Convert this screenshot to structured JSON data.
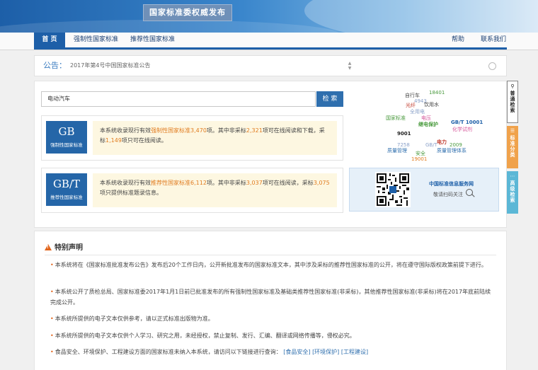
{
  "header": {
    "banner_title": "国家标准委权威发布"
  },
  "nav": {
    "left": [
      "首 页",
      "强制性国家标准",
      "推荐性国家标准"
    ],
    "right": [
      "帮助",
      "联系我们"
    ]
  },
  "notice": {
    "label": "公告：",
    "text": "2017年第4号中国国家标准公告"
  },
  "search": {
    "value": "电动汽车",
    "button_label": "检 索"
  },
  "gb": {
    "code": "GB",
    "name": "强制性国家标准",
    "desc_prefix": "本系统收录现行有效",
    "desc_link": "强制性国家标准",
    "total": "3,470",
    "desc_mid1": "项。其中非采标",
    "non_adopted": "2,321",
    "desc_mid2": "项可在线阅读和下载，采标",
    "adopted": "1,149",
    "desc_end": "项只可在线阅读。"
  },
  "gbt": {
    "code": "GB/T",
    "name": "推荐性国家标准",
    "desc_prefix": "本系统收录现行有效",
    "desc_link": "推荐性国家标准",
    "total": "6,112",
    "desc_mid1": "项。其中非采标",
    "non_adopted": "3,037",
    "desc_mid2": "项可在线阅读，采标",
    "adopted": "3,075",
    "desc_end": "项只提供标准题录信息。"
  },
  "word_cloud": [
    {
      "text": "18401",
      "color": "#4a9a3e"
    },
    {
      "text": "自行车",
      "color": "#444444"
    },
    {
      "text": "4943",
      "color": "#8aa0c8"
    },
    {
      "text": "光纤",
      "color": "#c0392b"
    },
    {
      "text": "饮用水",
      "color": "#444444"
    },
    {
      "text": "全用电",
      "color": "#8aa0c8"
    },
    {
      "text": "国家标准",
      "color": "#4a9a3e"
    },
    {
      "text": "电压",
      "color": "#d6569a"
    },
    {
      "text": "继电保护",
      "color": "#4a9a3e"
    },
    {
      "text": "GB/T 10001",
      "color": "#1d5fa8"
    },
    {
      "text": "化学试剂",
      "color": "#d6569a"
    },
    {
      "text": "9001",
      "color": "#222222"
    },
    {
      "text": "7258",
      "color": "#8aa0c8"
    },
    {
      "text": "GB/T",
      "color": "#8aa0c8"
    },
    {
      "text": "电力",
      "color": "#c0392b"
    },
    {
      "text": "2009",
      "color": "#4a9a3e"
    },
    {
      "text": "质量管理",
      "color": "#2f6fae"
    },
    {
      "text": "安全",
      "color": "#4a9a3e"
    },
    {
      "text": "质量管理体系",
      "color": "#2f6fae"
    },
    {
      "text": "19001",
      "color": "#e07b1f"
    }
  ],
  "qr": {
    "title": "中国标准信息服务网",
    "subtitle": "敬请扫码关注"
  },
  "side_tabs": [
    {
      "label": "普通检索"
    },
    {
      "label": "标准分类"
    },
    {
      "label": "高级检索"
    }
  ],
  "statement": {
    "title": "特别声明",
    "items": [
      "本系统将在《国家标准批准发布公告》发布后20个工作日内，公开新批准发布的国家标准文本，其中涉及采标的推荐性国家标准的公开，将在遵守国际版权政策前提下进行。",
      "本系统公开了质检总局、国家标准委2017年1月1日前已批准发布的所有强制性国家标准及基础类推荐性国家标准(非采标)，其他推荐性国家标准(非采标)将在2017年底前陆续完成公开。",
      "本系统所提供的电子文本仅供参考，请以正式标准出版物为准。",
      "本系统所提供的电子文本仅供个人学习、研究之用，未经授权，禁止复制、发行、汇编、翻译或网络传播等，侵权必究。",
      "食品安全、环境保护、工程建设方面的国家标准未纳入本系统，请访问以下链接进行查询："
    ],
    "links": [
      "[食品安全]",
      "[环境保护]",
      "[工程建设]"
    ]
  },
  "colors": {
    "primary": "#1d5fa8",
    "highlight": "#e07b1f",
    "desc_bg": "#fdf7e1",
    "tab_orange": "#f0a24b",
    "tab_cyan": "#5bb7d6"
  }
}
